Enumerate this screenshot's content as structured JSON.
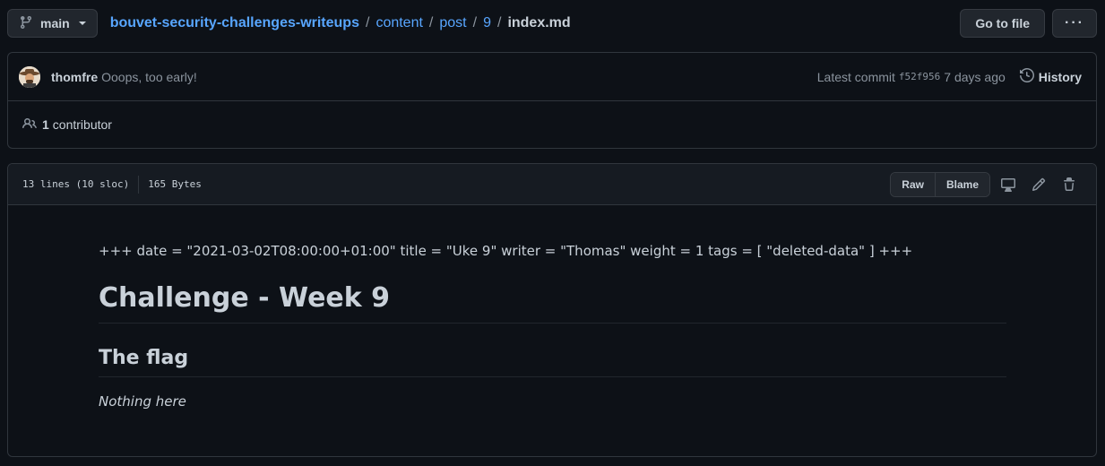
{
  "branch": {
    "label": "main"
  },
  "breadcrumb": {
    "repo": "bouvet-security-challenges-writeups",
    "parts": [
      "content",
      "post",
      "9"
    ],
    "file": "index.md",
    "separator": "/"
  },
  "toolbar": {
    "go_to_file": "Go to file",
    "more": "···"
  },
  "commit": {
    "author": "thomfre",
    "message": "Ooops, too early!",
    "latest_label": "Latest commit",
    "sha": "f52f956",
    "time": "7 days ago",
    "history_label": "History"
  },
  "contributors": {
    "count": "1",
    "label": "contributor"
  },
  "file": {
    "lines": "13 lines (10 sloc)",
    "size": "165 Bytes",
    "raw_label": "Raw",
    "blame_label": "Blame"
  },
  "content": {
    "front_matter": "+++ date = \"2021-03-02T08:00:00+01:00\" title = \"Uke 9\" writer = \"Thomas\" weight = 1 tags = [ \"deleted-data\" ] +++",
    "heading1": "Challenge - Week 9",
    "heading2": "The flag",
    "paragraph": "Nothing here"
  },
  "icons": {
    "branch": "git-branch-icon",
    "history": "history-icon",
    "contributors": "people-icon",
    "display": "desktop-icon",
    "edit": "pencil-icon",
    "delete": "trash-icon"
  },
  "colors": {
    "link": "#58a6ff",
    "background": "#0d1117",
    "muted": "#8b949e"
  }
}
